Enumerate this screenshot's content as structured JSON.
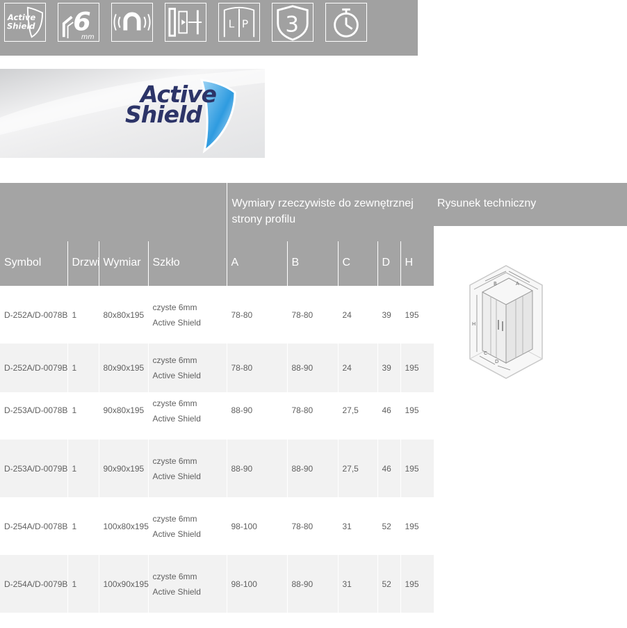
{
  "features": {
    "icons": [
      {
        "name": "active-shield-icon",
        "label": "Active Shield"
      },
      {
        "name": "glass-6mm-icon",
        "label": "6",
        "unit": "mm"
      },
      {
        "name": "magnet-icon"
      },
      {
        "name": "adjustment-profile-icon"
      },
      {
        "name": "left-right-icon",
        "label": "L P"
      },
      {
        "name": "warranty-3-icon",
        "label": "3"
      },
      {
        "name": "timer-icon"
      }
    ]
  },
  "banner": {
    "line1": "Active",
    "line2": "Shield"
  },
  "table": {
    "group_header": "Wymiary rzeczywiste do zewnętrznej strony profilu",
    "headers": {
      "symbol": "Symbol",
      "door": "Drzwi",
      "size": "Wymiar",
      "glass": "Szkło",
      "a": "A",
      "b": "B",
      "c": "C",
      "d": "D",
      "h": "H"
    },
    "rows": [
      {
        "symbol": "D-252A/D-0078B",
        "door": "1",
        "size": "80x80x195",
        "glass1": "czyste 6mm",
        "glass2": "Active Shield",
        "a": "78-80",
        "b": "78-80",
        "c": "24",
        "d": "39",
        "h": "195"
      },
      {
        "symbol": "D-252A/D-0079B",
        "door": "1",
        "size": "80x90x195",
        "glass1": "czyste 6mm",
        "glass2": "Active Shield",
        "a": "78-80",
        "b": "88-90",
        "c": "24",
        "d": "39",
        "h": "195"
      },
      {
        "symbol": "D-253A/D-0078B",
        "door": "1",
        "size": "90x80x195",
        "glass1": "czyste 6mm",
        "glass2": "Active Shield",
        "a": "88-90",
        "b": "78-80",
        "c": "27,5",
        "d": "46",
        "h": "195"
      },
      {
        "symbol": "D-253A/D-0079B",
        "door": "1",
        "size": "90x90x195",
        "glass1": "czyste 6mm",
        "glass2": "Active Shield",
        "a": "88-90",
        "b": "88-90",
        "c": "27,5",
        "d": "46",
        "h": "195"
      },
      {
        "symbol": "D-254A/D-0078B",
        "door": "1",
        "size": "100x80x195",
        "glass1": "czyste 6mm",
        "glass2": "Active Shield",
        "a": "98-100",
        "b": "78-80",
        "c": "31",
        "d": "52",
        "h": "195"
      },
      {
        "symbol": "D-254A/D-0079B",
        "door": "1",
        "size": "100x90x195",
        "glass1": "czyste 6mm",
        "glass2": "Active Shield",
        "a": "98-100",
        "b": "88-90",
        "c": "31",
        "d": "52",
        "h": "195"
      }
    ]
  },
  "technical": {
    "header": "Rysunek techniczny",
    "labels": {
      "a": "A",
      "b": "B",
      "c": "C",
      "d": "D",
      "h": "H"
    }
  }
}
